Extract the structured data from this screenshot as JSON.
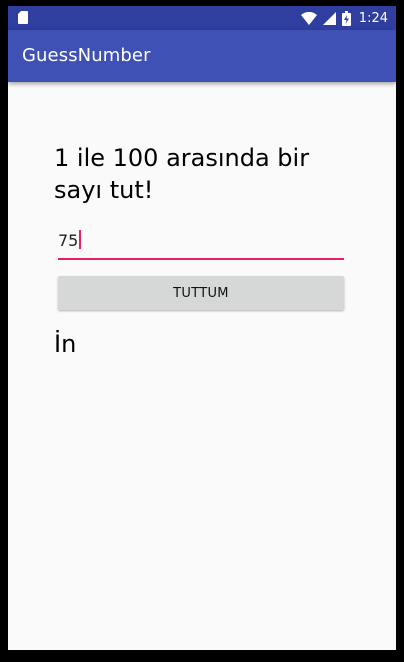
{
  "status_bar": {
    "time": "1:24",
    "icons": [
      "sd-card-icon",
      "wifi-icon",
      "signal-icon",
      "battery-charging-icon"
    ]
  },
  "app_bar": {
    "title": "GuessNumber"
  },
  "main": {
    "prompt": "1 ile 100 arasında bir sayı tut!",
    "number_input_value": "75",
    "guess_button_label": "TUTTUM",
    "result_text": "İn"
  },
  "colors": {
    "status_bar": "#303f9f",
    "app_bar": "#3f51b5",
    "accent": "#e91e63",
    "background": "#fafafa",
    "button": "#d6d7d7"
  }
}
